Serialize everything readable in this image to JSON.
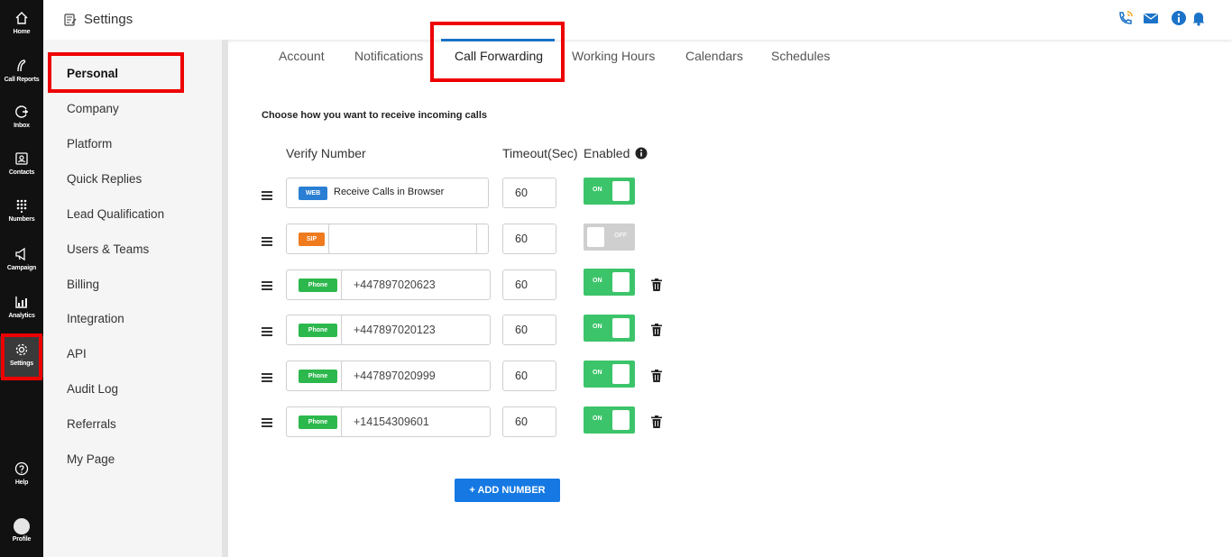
{
  "rail": {
    "home": "Home",
    "call_reports": "Call Reports",
    "inbox": "Inbox",
    "contacts": "Contacts",
    "numbers": "Numbers",
    "campaign": "Campaign",
    "analytics": "Analytics",
    "settings": "Settings",
    "help": "Help",
    "profile": "Profile"
  },
  "header": {
    "title": "Settings"
  },
  "sidebar": {
    "items": [
      "Personal",
      "Company",
      "Platform",
      "Quick Replies",
      "Lead Qualification",
      "Users & Teams",
      "Billing",
      "Integration",
      "API",
      "Audit Log",
      "Referrals",
      "My Page"
    ],
    "active": "Personal"
  },
  "tabs": [
    "Account",
    "Notifications",
    "Call Forwarding",
    "Working Hours",
    "Calendars",
    "Schedules"
  ],
  "active_tab": "Call Forwarding",
  "section": {
    "heading": "Choose how you want to receive incoming calls",
    "col_number": "Verify Number",
    "col_timeout": "Timeout(Sec)",
    "col_enabled": "Enabled"
  },
  "rows": [
    {
      "type_badge": "WEB",
      "number": "Receive Calls in Browser",
      "timeout": "60",
      "toggle": "ON"
    },
    {
      "type_badge": "SIP",
      "number": "",
      "timeout": "60",
      "toggle": "OFF"
    },
    {
      "type_badge": "Phone",
      "number": "+447897020623",
      "timeout": "60",
      "toggle": "ON"
    },
    {
      "type_badge": "Phone",
      "number": "+447897020123",
      "timeout": "60",
      "toggle": "ON"
    },
    {
      "type_badge": "Phone",
      "number": "+447897020999",
      "timeout": "60",
      "toggle": "ON"
    },
    {
      "type_badge": "Phone",
      "number": "+14154309601",
      "timeout": "60",
      "toggle": "ON"
    }
  ],
  "add_button": "+ ADD NUMBER",
  "colors": {
    "rail_bg": "#111111",
    "accent_blue": "#1679e3",
    "toggle_on": "#3cc46a",
    "toggle_off": "#cfcfcf",
    "badge_web": "#2a7fd4",
    "badge_sip": "#f07a1e",
    "badge_phone": "#2db84d",
    "highlight_red": "#ee0000"
  }
}
